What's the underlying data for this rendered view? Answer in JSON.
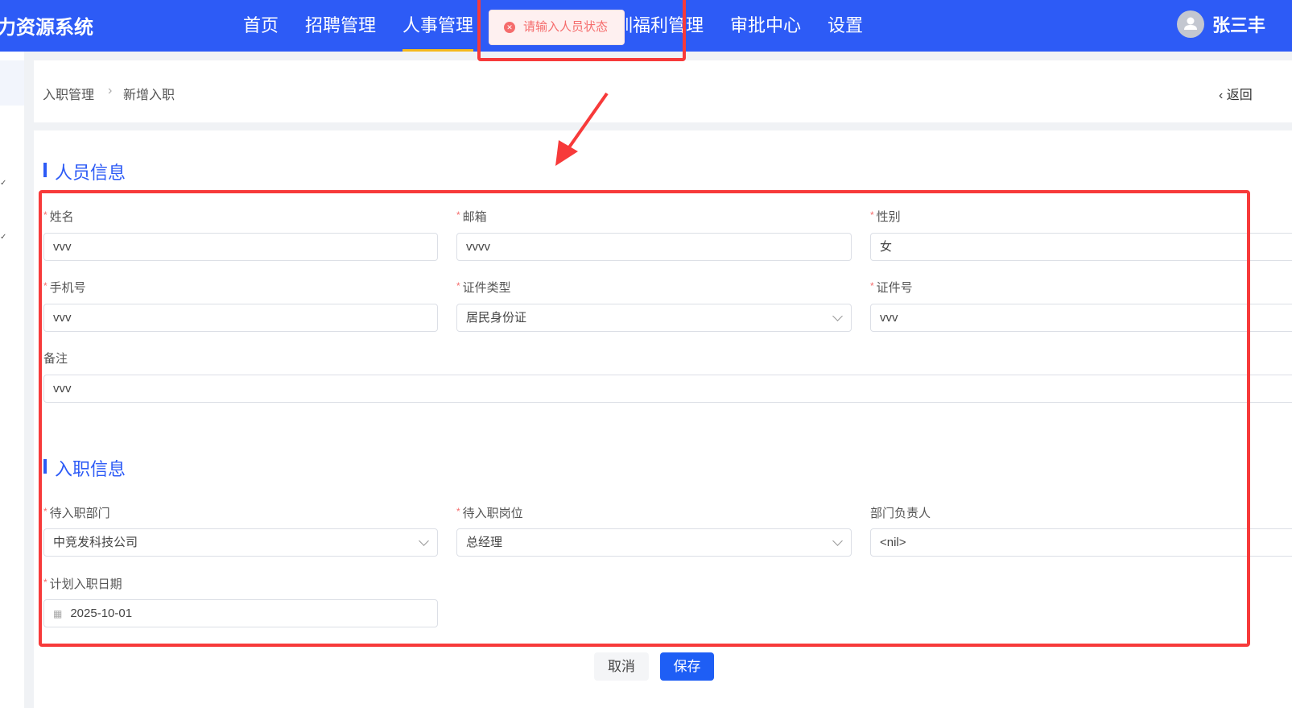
{
  "header": {
    "brand": "力资源系统",
    "nav": [
      {
        "label": "首页"
      },
      {
        "label": "招聘管理"
      },
      {
        "label": "人事管理",
        "active": true
      },
      {
        "label": "培训福利管理"
      },
      {
        "label": "审批中心"
      },
      {
        "label": "设置"
      }
    ],
    "user_name": "张三丰",
    "avatar_icon": "user-icon"
  },
  "toast": {
    "type": "error",
    "icon": "error-circle-icon",
    "message": "请输入人员状态"
  },
  "breadcrumb": {
    "items": [
      "入职管理",
      "新增入职"
    ],
    "back_label": "返回"
  },
  "sections": {
    "personal": {
      "title": "人员信息",
      "fields": {
        "name": {
          "label": "姓名",
          "required": true,
          "value": "vvv"
        },
        "email": {
          "label": "邮箱",
          "required": true,
          "value": "vvvv"
        },
        "gender": {
          "label": "性别",
          "required": true,
          "value": "女"
        },
        "phone": {
          "label": "手机号",
          "required": true,
          "value": "vvv"
        },
        "id_type": {
          "label": "证件类型",
          "required": true,
          "value": "居民身份证"
        },
        "id_number": {
          "label": "证件号",
          "required": true,
          "value": "vvv"
        },
        "remark": {
          "label": "备注",
          "required": false,
          "value": "vvv"
        }
      }
    },
    "onboarding": {
      "title": "入职信息",
      "fields": {
        "department": {
          "label": "待入职部门",
          "required": true,
          "value": "中竞发科技公司"
        },
        "position": {
          "label": "待入职岗位",
          "required": true,
          "value": "总经理"
        },
        "manager": {
          "label": "部门负责人",
          "required": false,
          "value": "<nil>"
        },
        "date": {
          "label": "计划入职日期",
          "required": true,
          "value": "2025-10-01"
        }
      }
    }
  },
  "actions": {
    "cancel": "取消",
    "save": "保存"
  },
  "colors": {
    "primary": "#2d5bf6",
    "active_underline": "#f5b91c",
    "error": "#f56c6c",
    "annotation": "#f73a3a"
  }
}
